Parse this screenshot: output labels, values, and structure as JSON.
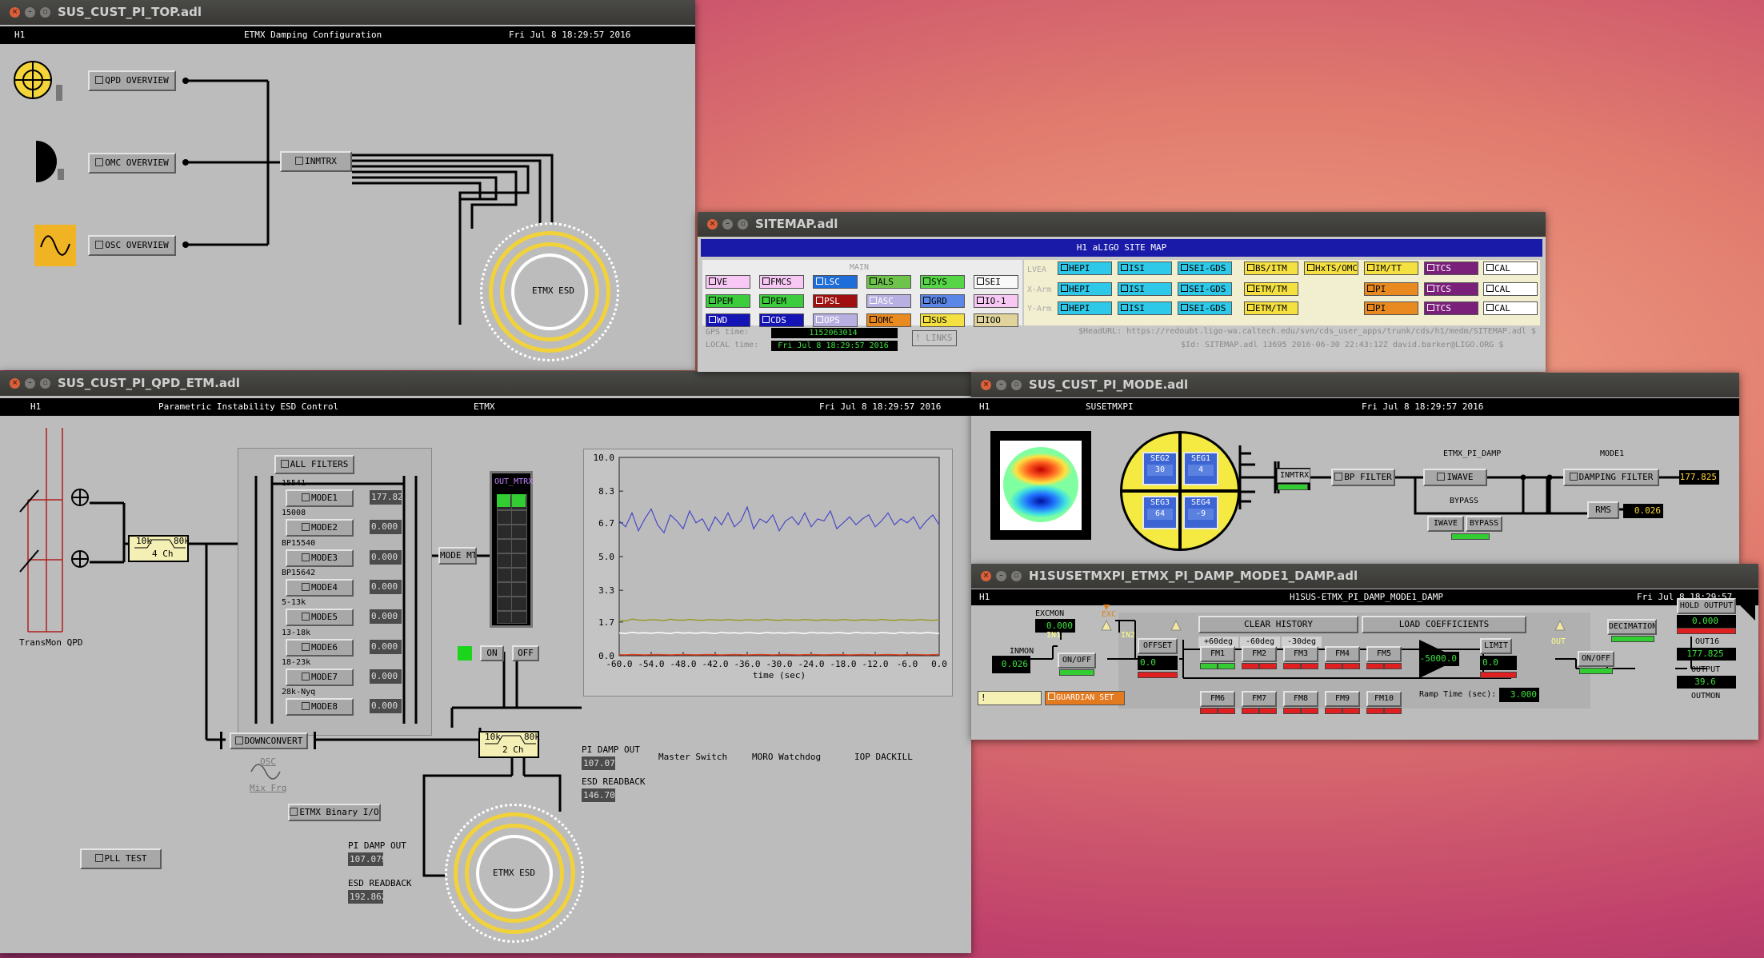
{
  "w1": {
    "title": "SUS_CUST_PI_TOP.adl",
    "hdr_ifo": "H1",
    "hdr_center": "ETMX Damping Configuration",
    "hdr_time": "Fri Jul  8 18:29:57 2016",
    "qpd_btn": "QPD OVERVIEW",
    "omc_btn": "OMC OVERVIEW",
    "osc_btn": "OSC OVERVIEW",
    "inmtrx_btn": "INMTRX",
    "esd_label": "ETMX ESD"
  },
  "w2": {
    "title": "SITEMAP.adl",
    "header": "H1 aLIGO SITE MAP",
    "main_label": "MAIN",
    "lvea_label": "LVEA",
    "xarm_label": "X-Arm",
    "yarm_label": "Y-Arm",
    "row_main1": [
      "VE",
      "FMCS",
      "LSC",
      "ALS",
      "SYS",
      "SEI"
    ],
    "row_main2": [
      "PEM",
      "PEM",
      "PSL",
      "ASC",
      "GRD",
      "IO-1"
    ],
    "row_main3": [
      "WD",
      "CDS",
      "OPS",
      "OMC",
      "SUS",
      "IOO"
    ],
    "row_lvea": [
      "HEPI",
      "ISI",
      "SEI-GDS",
      "BS/ITM",
      "HxTS/OMC",
      "IM/TT",
      "TCS",
      "CAL"
    ],
    "row_xarm": [
      "HEPI",
      "ISI",
      "SEI-GDS",
      "ETM/TM",
      "PI",
      "TCS",
      "CAL"
    ],
    "row_yarm": [
      "HEPI",
      "ISI",
      "SEI-GDS",
      "ETM/TM",
      "PI",
      "TCS",
      "CAL"
    ],
    "gps_label": "GPS time:",
    "gps_value": "1152063014",
    "local_label": "LOCAL time:",
    "local_value": "Fri Jul  8 18:29:57 2016",
    "links_btn": "! LINKS",
    "headurl": "$HeadURL: https://redoubt.ligo-wa.caltech.edu/svn/cds_user_apps/trunk/cds/h1/medm/SITEMAP.adl $",
    "id_line": "$Id: SITEMAP.adl 13695 2016-06-30 22:43:12Z david.barker@LIGO.ORG $",
    "colors": {
      "header": "#1a1aa8",
      "main_bg": "#e8e8e8",
      "lvea_bg": "#f2ecc4"
    }
  },
  "w3": {
    "title": "SUS_CUST_PI_QPD_ETM.adl",
    "hdr_ifo": "H1",
    "hdr_center": "Parametric Instability ESD Control",
    "hdr_optic": "ETMX",
    "hdr_time": "Fri Jul  8 18:29:57 2016",
    "all_filters": "ALL FILTERS",
    "modes": [
      {
        "label": "MODE1",
        "freq": "15541",
        "value": "177.825"
      },
      {
        "label": "MODE2",
        "freq": "15008",
        "value": "0.000"
      },
      {
        "label": "MODE3",
        "freq": "BP15540",
        "value": "0.000"
      },
      {
        "label": "MODE4",
        "freq": "BP15642",
        "value": "0.000"
      },
      {
        "label": "MODE5",
        "freq": "5-13k",
        "value": "0.000"
      },
      {
        "label": "MODE6",
        "freq": "13-18k",
        "value": "0.000"
      },
      {
        "label": "MODE7",
        "freq": "18-23k",
        "value": "0.000"
      },
      {
        "label": "MODE8",
        "freq": "28k-Nyq",
        "value": "0.000"
      }
    ],
    "filter1_low": "10k",
    "filter1_high": "80k",
    "filter1_ch": "4 Ch",
    "filter2_low": "10k",
    "filter2_high": "80k",
    "filter2_ch": "2 Ch",
    "mode_mtx_btn": "MODE MT",
    "out_mtrx": "OUT_MTRX",
    "on_btn": "ON",
    "off_btn": "OFF",
    "transmon_qpd": "TransMon QPD",
    "downconvert_btn": "DOWNCONVERT",
    "osc_label": "OSC",
    "mix_frq_label": "Mix Frq",
    "binary_io_btn": "ETMX Binary I/O",
    "pll_test_btn": "PLL TEST",
    "esd_label": "ETMX ESD",
    "pi_damp_out_label": "PI DAMP OUT",
    "pi_damp_out_value": "107.079",
    "esd_readback_label": "ESD READBACK",
    "esd_readback_value": "146.700",
    "pi_damp_out2_label": "PI DAMP OUT",
    "pi_damp_out2_value": "107.079",
    "esd_readback2_label": "ESD READBACK",
    "esd_readback2_value": "192.862",
    "master_switch": "Master Switch",
    "moro_watchdog": "MORO Watchdog",
    "iop_dackill": "IOP DACKILL"
  },
  "chart_data": {
    "type": "line",
    "title": "",
    "xlabel": "time (sec)",
    "ylabel": "",
    "xlim": [
      -60,
      0
    ],
    "ylim": [
      0,
      10
    ],
    "x_ticks": [
      "-60.0",
      "-54.0",
      "-48.0",
      "-42.0",
      "-36.0",
      "-30.0",
      "-24.0",
      "-18.0",
      "-12.0",
      "-6.0",
      "0.0"
    ],
    "y_ticks": [
      "10.0",
      "8.3",
      "6.7",
      "5.0",
      "3.3",
      "1.7",
      "0.0"
    ],
    "grid": false,
    "series": [
      {
        "color": "#4848c8",
        "values": [
          6.8,
          6.5,
          7.2,
          6.3,
          6.9,
          7.4,
          6.6,
          6.2,
          7.1,
          6.8,
          6.4,
          7.3,
          6.7,
          6.9,
          6.3,
          7.0,
          6.6,
          7.2,
          6.5,
          6.8,
          7.5,
          6.4,
          6.9,
          6.7,
          7.1,
          6.3,
          6.8,
          7.0,
          6.6,
          7.2,
          6.5,
          6.9,
          6.8,
          7.3,
          6.4,
          6.7,
          7.0,
          6.6,
          6.9,
          7.1,
          6.5,
          6.8,
          7.2,
          6.6,
          6.9,
          6.7,
          7.0,
          6.4,
          6.8,
          7.1,
          6.6
        ]
      },
      {
        "color": "#9a9a2e",
        "values": [
          1.8,
          1.75,
          1.85,
          1.8,
          1.78,
          1.82,
          1.8,
          1.77,
          1.84,
          1.8,
          1.79,
          1.83,
          1.8,
          1.78,
          1.82,
          1.81,
          1.79,
          1.83,
          1.8,
          1.78,
          1.82,
          1.8,
          1.79,
          1.84,
          1.8,
          1.78,
          1.82,
          1.8,
          1.79,
          1.83,
          1.8,
          1.78,
          1.82,
          1.8,
          1.79,
          1.83,
          1.8,
          1.78,
          1.82,
          1.8,
          1.79,
          1.83,
          1.8,
          1.78,
          1.82,
          1.8,
          1.79,
          1.83,
          1.8,
          1.78,
          1.82
        ]
      },
      {
        "color": "#ffffff",
        "values": [
          1.15,
          1.12,
          1.18,
          1.14,
          1.16,
          1.13,
          1.17,
          1.15,
          1.12,
          1.18,
          1.14,
          1.16,
          1.13,
          1.17,
          1.15,
          1.12,
          1.18,
          1.14,
          1.16,
          1.13,
          1.17,
          1.15,
          1.12,
          1.18,
          1.14,
          1.16,
          1.13,
          1.17,
          1.15,
          1.12,
          1.18,
          1.14,
          1.16,
          1.13,
          1.17,
          1.15,
          1.12,
          1.18,
          1.14,
          1.16,
          1.13,
          1.17,
          1.15,
          1.12,
          1.18,
          1.14,
          1.16,
          1.13,
          1.17,
          1.15,
          1.12
        ]
      },
      {
        "color": "#d84020",
        "values": [
          0.05,
          0.04,
          0.06,
          0.05,
          0.04,
          0.05,
          0.06,
          0.05,
          0.04,
          0.05,
          0.06,
          0.05,
          0.04,
          0.05,
          0.06,
          0.05,
          0.04,
          0.05,
          0.06,
          0.05,
          0.04,
          0.05,
          0.06,
          0.05,
          0.04,
          0.05,
          0.06,
          0.05,
          0.04,
          0.05,
          0.06,
          0.05,
          0.04,
          0.05,
          0.06,
          0.05,
          0.04,
          0.05,
          0.06,
          0.05,
          0.04,
          0.05,
          0.06,
          0.05,
          0.04,
          0.05,
          0.06,
          0.05,
          0.04,
          0.05,
          0.06
        ]
      }
    ]
  },
  "w4": {
    "title": "SUS_CUST_PI_MODE.adl",
    "hdr_ifo": "H1",
    "hdr_center": "SUSETMXPI",
    "hdr_time": "Fri Jul  8 18:29:57 2016",
    "etmx_pi_damp": "ETMX_PI_DAMP",
    "mode1": "MODE1",
    "segments": [
      {
        "name": "SEG2",
        "value": "30"
      },
      {
        "name": "SEG1",
        "value": "4"
      },
      {
        "name": "SEG3",
        "value": "64"
      },
      {
        "name": "SEG4",
        "value": "-9"
      }
    ],
    "inmtrx_btn": "INMTRX",
    "bp_filter_btn": "BP FILTER",
    "iwave_btn": "IWAVE",
    "damping_filter_btn": "DAMPING FILTER",
    "output_value": "177.825",
    "bypass_label": "BYPASS",
    "iwave_small": "IWAVE",
    "bypass_small": "BYPASS",
    "rms_btn": "RMS",
    "rms_value": "0.026"
  },
  "w5": {
    "title": "H1SUSETMXPI_ETMX_PI_DAMP_MODE1_DAMP.adl",
    "hdr_ifo": "H1",
    "hdr_center": "H1SUS-ETMX_PI_DAMP_MODE1_DAMP",
    "hdr_time": "Fri Jul  8 18:29:57",
    "excmon_label": "EXCMON",
    "excmon_value": "0.000",
    "exc_label": "EXC",
    "inmon_label": "INMON",
    "inmon_value": "0.026",
    "in1_label": "IN1",
    "in2_label": "IN2",
    "onoff_btn": "ON/OFF",
    "offset_btn": "OFFSET",
    "offset_value": "0.0",
    "clear_history": "CLEAR HISTORY",
    "load_coeffs": "LOAD COEFFICIENTS",
    "fm_top_labels": [
      "+60deg",
      "-60deg",
      "-30deg"
    ],
    "fm_top": [
      "FM1",
      "FM2",
      "FM3",
      "FM4",
      "FM5"
    ],
    "fm_bottom": [
      "FM6",
      "FM7",
      "FM8",
      "FM9",
      "FM10"
    ],
    "gain_value": "-5000.0",
    "limit_btn": "LIMIT",
    "limit_value": "0.0",
    "ramp_label": "Ramp Time (sec):",
    "ramp_value": "3.000",
    "out_label": "OUT",
    "onoff2_btn": "ON/OFF",
    "decimation_btn": "DECIMATION",
    "hold_output_btn": "HOLD OUTPUT",
    "hold_value": "0.000",
    "out16_label": "OUT16",
    "out16_value": "177.825",
    "output_label": "OUTPUT",
    "output_value": "39.6",
    "outmon_label": "OUTMON",
    "excl_btn": "!",
    "guardian_btn": "GUARDIAN SET"
  }
}
